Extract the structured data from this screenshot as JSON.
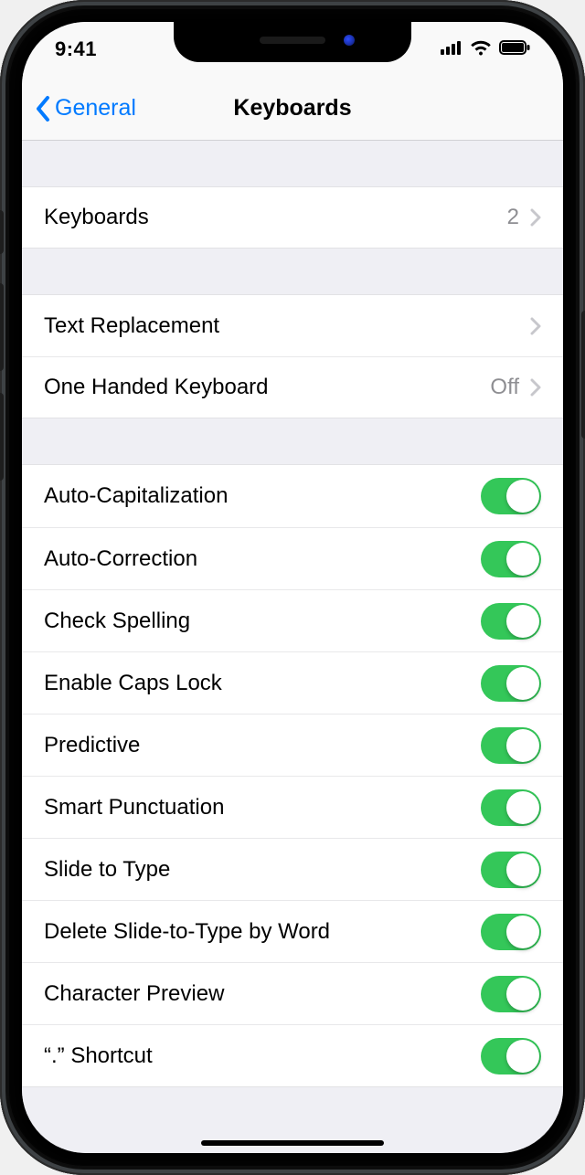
{
  "status": {
    "time": "9:41"
  },
  "nav": {
    "back_label": "General",
    "title": "Keyboards"
  },
  "group1": {
    "keyboards_label": "Keyboards",
    "keyboards_count": "2"
  },
  "group2": {
    "text_replacement_label": "Text Replacement",
    "one_handed_label": "One Handed Keyboard",
    "one_handed_value": "Off"
  },
  "toggles": [
    {
      "label": "Auto-Capitalization",
      "on": true
    },
    {
      "label": "Auto-Correction",
      "on": true
    },
    {
      "label": "Check Spelling",
      "on": true
    },
    {
      "label": "Enable Caps Lock",
      "on": true
    },
    {
      "label": "Predictive",
      "on": true
    },
    {
      "label": "Smart Punctuation",
      "on": true
    },
    {
      "label": "Slide to Type",
      "on": true
    },
    {
      "label": "Delete Slide-to-Type by Word",
      "on": true
    },
    {
      "label": "Character Preview",
      "on": true
    },
    {
      "label": "“.” Shortcut",
      "on": true
    }
  ]
}
